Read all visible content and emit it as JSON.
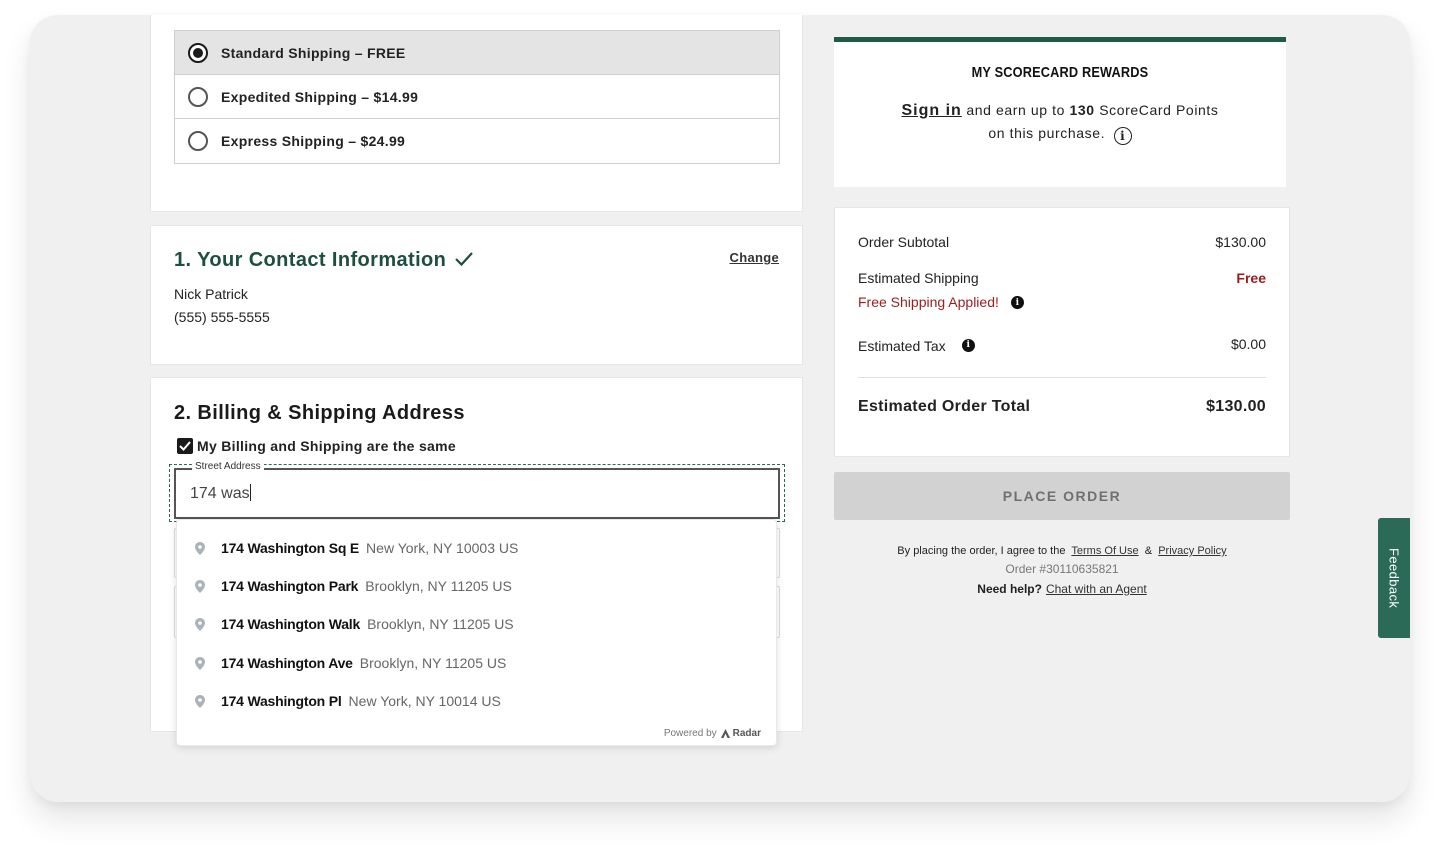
{
  "shipping": {
    "options": [
      {
        "label": "Standard Shipping – FREE",
        "selected": true
      },
      {
        "label": "Expedited Shipping – $14.99",
        "selected": false
      },
      {
        "label": "Express Shipping – $24.99",
        "selected": false
      }
    ]
  },
  "contact": {
    "title": "1. Your Contact Information",
    "change_label": "Change",
    "name": "Nick Patrick",
    "phone": "(555) 555-5555"
  },
  "billing": {
    "title": "2. Billing & Shipping Address",
    "same_label": "My Billing and Shipping are the same",
    "same_checked": true,
    "street_label": "Street Address",
    "street_value": "174 was"
  },
  "autocomplete": {
    "suggestions": [
      {
        "street": "174 Washington Sq E",
        "city": "New York, NY 10003 US"
      },
      {
        "street": "174 Washington Park",
        "city": "Brooklyn, NY 11205 US"
      },
      {
        "street": "174 Washington Walk",
        "city": "Brooklyn, NY 11205 US"
      },
      {
        "street": "174 Washington Ave",
        "city": "Brooklyn, NY 11205 US"
      },
      {
        "street": "174 Washington Pl",
        "city": "New York, NY 10014 US"
      }
    ],
    "powered_by": "Powered by",
    "provider": "Radar"
  },
  "rewards": {
    "title": "MY SCORECARD REWARDS",
    "sign_in": "Sign in",
    "text_before_points": "and earn up to",
    "points": "130",
    "text_after_points": "ScoreCard Points",
    "line2": "on this purchase."
  },
  "summary": {
    "subtotal_label": "Order Subtotal",
    "subtotal_value": "$130.00",
    "shipping_label": "Estimated Shipping",
    "shipping_value": "Free",
    "free_shipping_note": "Free Shipping Applied!",
    "tax_label": "Estimated Tax",
    "tax_value": "$0.00",
    "total_label": "Estimated Order Total",
    "total_value": "$130.00"
  },
  "place_order_label": "PLACE ORDER",
  "legal": {
    "agree_text": "By placing the order, I agree to the",
    "terms": "Terms Of Use",
    "amp": "&",
    "privacy": "Privacy Policy",
    "order_number": "Order #30110635821",
    "need_help": "Need help?",
    "chat": "Chat with an Agent"
  },
  "feedback_label": "Feedback",
  "colors": {
    "brand_green": "#1e5c48",
    "sale_red": "#9b1c1c",
    "disabled_button": "#d2d2d2"
  }
}
